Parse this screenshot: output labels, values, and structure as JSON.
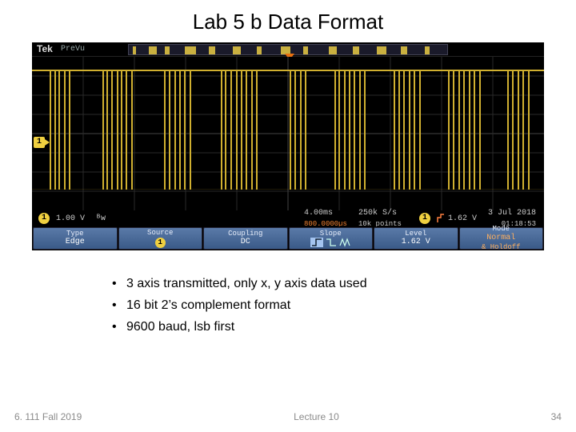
{
  "slide": {
    "title": "Lab 5 b Data Format"
  },
  "scope": {
    "brand": "Tek",
    "mode": "PreVu",
    "ch": "1",
    "readout": {
      "vdiv": "1.00 V",
      "bw": "ᴮw",
      "tdiv": "4.00ms",
      "sample": "250k S/s",
      "points": "10k points",
      "trig_ch": "1",
      "trig_level": "1.62 V",
      "date": "3 Jul 2018",
      "time": "01:18:53",
      "tbase_offset": "800.0000µs"
    },
    "menu": {
      "type_label": "Type",
      "type_val": "Edge",
      "source_label": "Source",
      "source_val": "1",
      "coupling_label": "Coupling",
      "coupling_val": "DC",
      "slope_label": "Slope",
      "level_label": "Level",
      "level_val": "1.62 V",
      "mode_label": "Mode",
      "mode_val1": "Normal",
      "mode_val2": "& Holdoff"
    }
  },
  "bullets": [
    "3 axis transmitted, only x, y axis data used",
    "16 bit 2’s complement format",
    "9600 baud, lsb first"
  ],
  "footer": {
    "left": "6. 111 Fall 2019",
    "center": "Lecture 10",
    "right": "34"
  }
}
